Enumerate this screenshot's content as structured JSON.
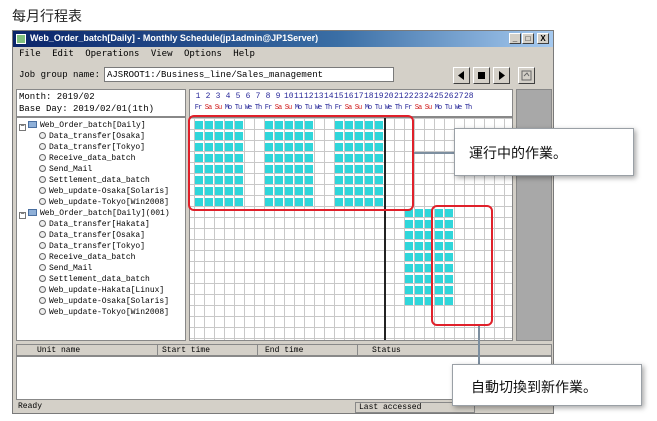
{
  "caption": "每月行程表",
  "window": {
    "title": "Web_Order_batch[Daily] - Monthly Schedule(jp1admin@JP1Server)",
    "buttons": [
      "_",
      "□",
      "X"
    ]
  },
  "menu": [
    "File",
    "Edit",
    "Operations",
    "View",
    "Options",
    "Help"
  ],
  "jobgroup": {
    "label": "Job group name:",
    "value": "AJSROOT1:/Business_line/Sales_management"
  },
  "header": {
    "month": "Month:   2019/02",
    "base_day": "Base Day: 2019/02/01(1th)"
  },
  "dates": {
    "days": [
      "1",
      "2",
      "3",
      "4",
      "5",
      "6",
      "7",
      "8",
      "9",
      "10",
      "11",
      "12",
      "13",
      "14",
      "15",
      "16",
      "17",
      "18",
      "19",
      "20",
      "21",
      "22",
      "23",
      "24",
      "25",
      "26",
      "27",
      "28"
    ],
    "weekdays": [
      "Fr",
      "Sa",
      "Su",
      "Mo",
      "Tu",
      "We",
      "Th",
      "Fr",
      "Sa",
      "Su",
      "Mo",
      "Tu",
      "We",
      "Th",
      "Fr",
      "Sa",
      "Su",
      "Mo",
      "Tu",
      "We",
      "Th",
      "Fr",
      "Sa",
      "Su",
      "Mo",
      "Tu",
      "We",
      "Th"
    ]
  },
  "tree": [
    {
      "label": "Web_Order_batch[Daily]",
      "type": "group"
    },
    {
      "label": "Data_transfer[Osaka]",
      "type": "job"
    },
    {
      "label": "Data_transfer[Tokyo]",
      "type": "job"
    },
    {
      "label": "Receive_data_batch",
      "type": "job"
    },
    {
      "label": "Send_Mail",
      "type": "job"
    },
    {
      "label": "Settlement_data_batch",
      "type": "job"
    },
    {
      "label": "Web_update-Osaka[Solaris]",
      "type": "job"
    },
    {
      "label": "Web_update-Tokyo[Win2008]",
      "type": "job"
    },
    {
      "label": "Web_Order_batch[Daily](001)",
      "type": "group"
    },
    {
      "label": "Data_transfer[Hakata]",
      "type": "job"
    },
    {
      "label": "Data_transfer[Osaka]",
      "type": "job"
    },
    {
      "label": "Data_transfer[Tokyo]",
      "type": "job"
    },
    {
      "label": "Receive_data_batch",
      "type": "job"
    },
    {
      "label": "Send_Mail",
      "type": "job"
    },
    {
      "label": "Settlement_data_batch",
      "type": "job"
    },
    {
      "label": "Web_update-Hakata[Linux]",
      "type": "job"
    },
    {
      "label": "Web_update-Osaka[Solaris]",
      "type": "job"
    },
    {
      "label": "Web_update-Tokyo[Win2008]",
      "type": "job"
    }
  ],
  "schedule": {
    "running_days": [
      1,
      2,
      3,
      4,
      5,
      8,
      9,
      10,
      11,
      12,
      15,
      16,
      17,
      18,
      19
    ],
    "running_rows": [
      0,
      1,
      2,
      3,
      4,
      5,
      6,
      7
    ],
    "new_days": [
      22,
      23,
      24,
      25,
      26
    ],
    "new_rows": [
      8,
      9,
      10,
      11,
      12,
      13,
      14,
      15,
      16
    ],
    "today_marker_day": 19
  },
  "bottom": {
    "columns": [
      "Unit name",
      "Start time",
      "End time",
      "Status"
    ]
  },
  "status": {
    "left": "Ready",
    "right": "Last accessed"
  },
  "callouts": {
    "running": "運行中的作業。",
    "auto_switch": "自動切換到新作業。"
  },
  "colors": {
    "cell": "#2fd6da",
    "highlight": "#e0202a",
    "weekend": "#d02020",
    "weekday": "#2a2a9a"
  }
}
